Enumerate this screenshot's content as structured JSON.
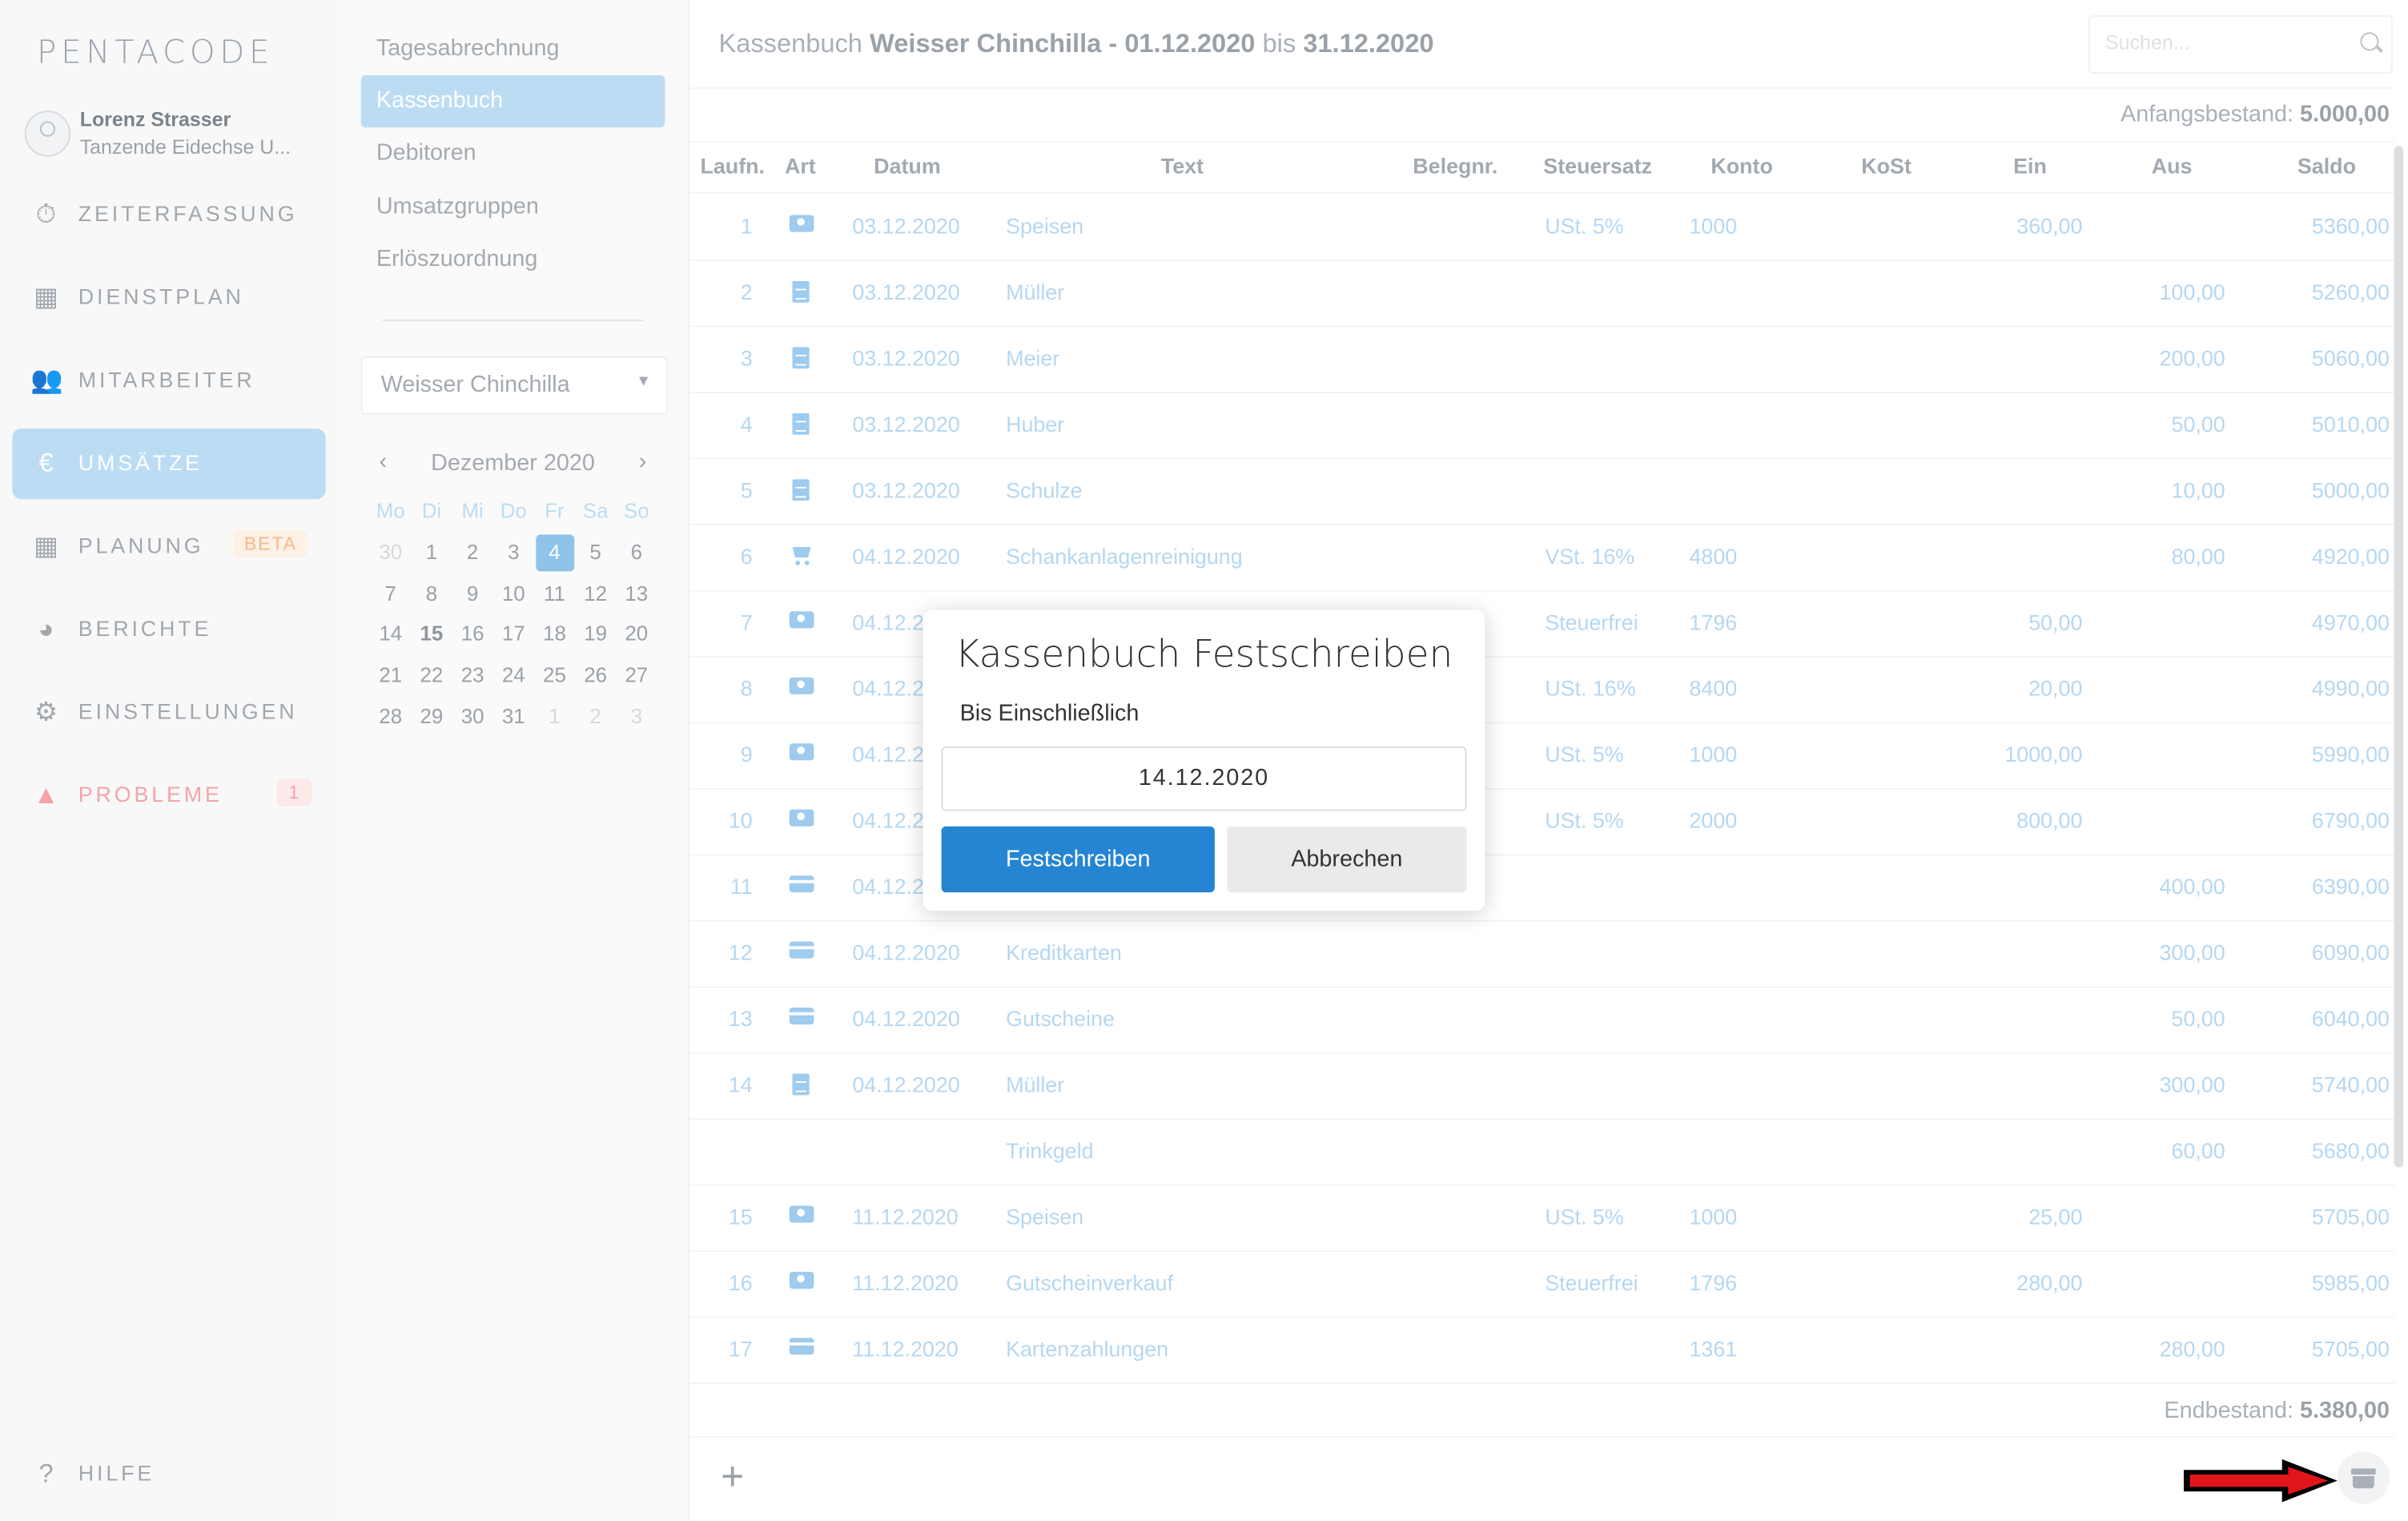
{
  "brand": {
    "logo": "PENTACODE"
  },
  "user": {
    "name": "Lorenz Strasser",
    "company": "Tanzende Eidechse U..."
  },
  "nav": {
    "items": [
      {
        "label": "ZEITERFASSUNG",
        "icon": "stopwatch-icon"
      },
      {
        "label": "DIENSTPLAN",
        "icon": "table-icon"
      },
      {
        "label": "MITARBEITER",
        "icon": "users-icon"
      },
      {
        "label": "UMSÄTZE",
        "icon": "euro-icon",
        "active": true
      },
      {
        "label": "PLANUNG",
        "icon": "calendar-icon",
        "badge": "BETA"
      },
      {
        "label": "BERICHTE",
        "icon": "pie-chart-icon"
      },
      {
        "label": "EINSTELLUNGEN",
        "icon": "gear-icon"
      },
      {
        "label": "PROBLEME",
        "icon": "warning-icon",
        "badge": "1"
      }
    ],
    "help": "HILFE"
  },
  "submenu": {
    "items": [
      "Tagesabrechnung",
      "Kassenbuch",
      "Debitoren",
      "Umsatzgruppen",
      "Erlöszuordnung"
    ],
    "active": "Kassenbuch",
    "location_select": "Weisser Chinchilla"
  },
  "calendar": {
    "month": "Dezember 2020",
    "weekdays": [
      "Mo",
      "Di",
      "Mi",
      "Do",
      "Fr",
      "Sa",
      "So"
    ],
    "days": [
      "30",
      "1",
      "2",
      "3",
      "4",
      "5",
      "6",
      "7",
      "8",
      "9",
      "10",
      "11",
      "12",
      "13",
      "14",
      "15",
      "16",
      "17",
      "18",
      "19",
      "20",
      "21",
      "22",
      "23",
      "24",
      "25",
      "26",
      "27",
      "28",
      "29",
      "30",
      "31",
      "1",
      "2",
      "3"
    ],
    "selected": "4",
    "today": "15"
  },
  "header": {
    "title_prefix": "Kassenbuch",
    "title_location": "Weisser Chinchilla - 01.12.2020",
    "title_mid": "bis",
    "title_end": "31.12.2020",
    "search_placeholder": "Suchen..."
  },
  "balance": {
    "start_label": "Anfangsbestand:",
    "start_value": "5.000,00",
    "end_label": "Endbestand:",
    "end_value": "5.380,00"
  },
  "table": {
    "columns": [
      "Laufn.",
      "Art",
      "Datum",
      "Text",
      "Belegnr.",
      "Steuersatz",
      "Konto",
      "KoSt",
      "Ein",
      "Aus",
      "Saldo"
    ],
    "rows": [
      {
        "nr": "1",
        "art": "cash",
        "date": "03.12.2020",
        "text": "Speisen",
        "tax": "USt. 5%",
        "konto": "1000",
        "ein": "360,00",
        "aus": "",
        "saldo": "5360,00"
      },
      {
        "nr": "2",
        "art": "doc",
        "date": "03.12.2020",
        "text": "Müller",
        "tax": "",
        "konto": "",
        "ein": "",
        "aus": "100,00",
        "saldo": "5260,00"
      },
      {
        "nr": "3",
        "art": "doc",
        "date": "03.12.2020",
        "text": "Meier",
        "tax": "",
        "konto": "",
        "ein": "",
        "aus": "200,00",
        "saldo": "5060,00"
      },
      {
        "nr": "4",
        "art": "doc",
        "date": "03.12.2020",
        "text": "Huber",
        "tax": "",
        "konto": "",
        "ein": "",
        "aus": "50,00",
        "saldo": "5010,00"
      },
      {
        "nr": "5",
        "art": "doc",
        "date": "03.12.2020",
        "text": "Schulze",
        "tax": "",
        "konto": "",
        "ein": "",
        "aus": "10,00",
        "saldo": "5000,00"
      },
      {
        "nr": "6",
        "art": "cart",
        "date": "04.12.2020",
        "text": "Schankanlagenreinigung",
        "tax": "VSt. 16%",
        "konto": "4800",
        "ein": "",
        "aus": "80,00",
        "saldo": "4920,00"
      },
      {
        "nr": "7",
        "art": "cash",
        "date": "04.12.2",
        "text": "",
        "tax": "Steuerfrei",
        "konto": "1796",
        "ein": "50,00",
        "aus": "",
        "saldo": "4970,00"
      },
      {
        "nr": "8",
        "art": "cash",
        "date": "04.12.2",
        "text": "",
        "tax": "USt. 16%",
        "konto": "8400",
        "ein": "20,00",
        "aus": "",
        "saldo": "4990,00"
      },
      {
        "nr": "9",
        "art": "cash",
        "date": "04.12.2",
        "text": "",
        "tax": "USt. 5%",
        "konto": "1000",
        "ein": "1000,00",
        "aus": "",
        "saldo": "5990,00"
      },
      {
        "nr": "10",
        "art": "cash",
        "date": "04.12.2",
        "text": "",
        "tax": "USt. 5%",
        "konto": "2000",
        "ein": "800,00",
        "aus": "",
        "saldo": "6790,00"
      },
      {
        "nr": "11",
        "art": "card",
        "date": "04.12.2",
        "text": "",
        "tax": "",
        "konto": "",
        "ein": "",
        "aus": "400,00",
        "saldo": "6390,00"
      },
      {
        "nr": "12",
        "art": "card",
        "date": "04.12.2020",
        "text": "Kreditkarten",
        "tax": "",
        "konto": "",
        "ein": "",
        "aus": "300,00",
        "saldo": "6090,00"
      },
      {
        "nr": "13",
        "art": "card",
        "date": "04.12.2020",
        "text": "Gutscheine",
        "tax": "",
        "konto": "",
        "ein": "",
        "aus": "50,00",
        "saldo": "6040,00"
      },
      {
        "nr": "14",
        "art": "doc",
        "date": "04.12.2020",
        "text": "Müller",
        "tax": "",
        "konto": "",
        "ein": "",
        "aus": "300,00",
        "saldo": "5740,00"
      },
      {
        "nr": "",
        "art": "",
        "date": "",
        "text": "Trinkgeld",
        "tax": "",
        "konto": "",
        "ein": "",
        "aus": "60,00",
        "saldo": "5680,00"
      },
      {
        "nr": "15",
        "art": "cash",
        "date": "11.12.2020",
        "text": "Speisen",
        "tax": "USt. 5%",
        "konto": "1000",
        "ein": "25,00",
        "aus": "",
        "saldo": "5705,00"
      },
      {
        "nr": "16",
        "art": "cash",
        "date": "11.12.2020",
        "text": "Gutscheinverkauf",
        "tax": "Steuerfrei",
        "konto": "1796",
        "ein": "280,00",
        "aus": "",
        "saldo": "5985,00"
      },
      {
        "nr": "17",
        "art": "card",
        "date": "11.12.2020",
        "text": "Kartenzahlungen",
        "tax": "",
        "konto": "1361",
        "ein": "",
        "aus": "280,00",
        "saldo": "5705,00"
      }
    ]
  },
  "dialog": {
    "title": "Kassenbuch Festschreiben",
    "label": "Bis Einschließlich",
    "date_value": "14.12.2020",
    "confirm": "Festschreiben",
    "cancel": "Abbrechen"
  },
  "colors": {
    "accent": "#2685d2",
    "active_nav": "#bcdcf3",
    "annotation_arrow": "#e0161b"
  }
}
